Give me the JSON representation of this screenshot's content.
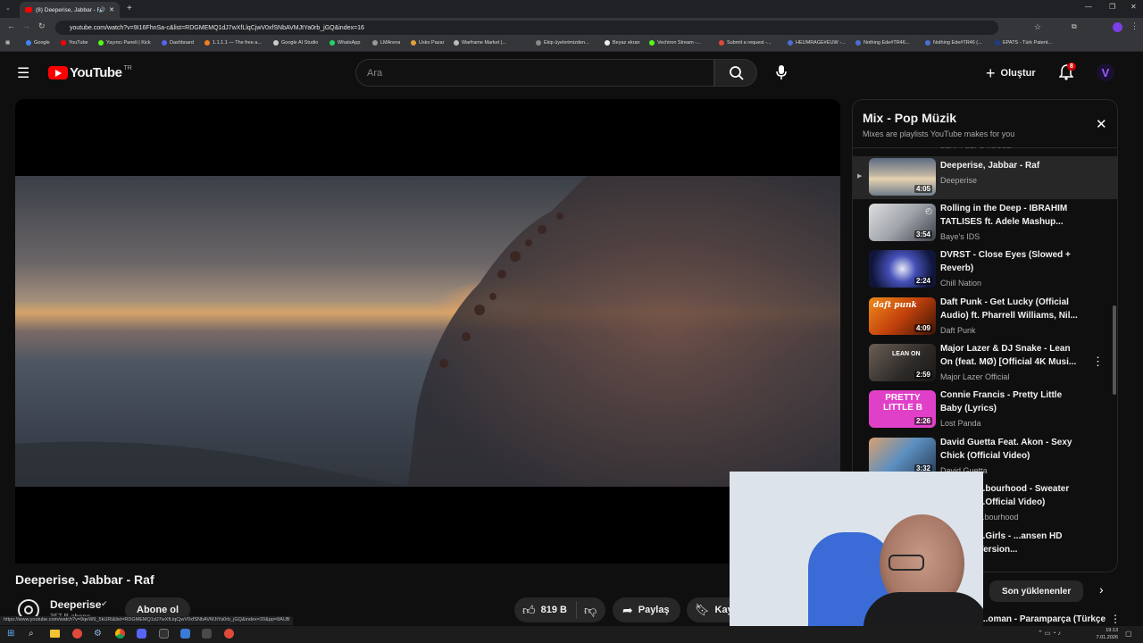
{
  "browser": {
    "tab_title": "(8) Deeperise, Jabbar - Raf",
    "url": "youtube.com/watch?v=9I16FhnSa-c&list=RDGMEMQ1dJ7wXfLlqCjwV0xfSNbAVMJtYa0rb_jGQ&index=16",
    "bookmarks": [
      "Google",
      "YouTube",
      "Yayıncı Paneli | Kick",
      "Dashboard",
      "1.1.1.1 — The free a...",
      "Google AI Studio",
      "WhatsApp",
      "LMArena",
      "Usko Pazar",
      "Warframe Market |...",
      "Ekip üyelerimizden...",
      "Beyaz ekran",
      "Vechiron Stream -...",
      "Submit a request -...",
      "HEUMRAGE#EUW -...",
      "Nothing Ede#TR46...",
      "Nothing Ede#TR46 (...",
      "EPATS - Türk Patent..."
    ],
    "status_url": "https://www.youtube.com/watch?v=9qeW9_5kURI&list=RDGMEMQ1dJ7wXfLlqCjwV0xfSNbAVMJtYa0rb_jGQ&index=20&pp=8AUB"
  },
  "header": {
    "logo": "YouTube",
    "region": "TR",
    "search_placeholder": "Ara",
    "create_label": "Oluştur",
    "notification_count": "8"
  },
  "playlist": {
    "title": "Mix - Pop Müzik",
    "subtitle": "Mixes are playlists YouTube makes for you",
    "partial_above": "BEAT PEEPS HOUSE",
    "items": [
      {
        "title": "Deeperise, Jabbar - Raf",
        "channel": "Deeperise",
        "duration": "4:05",
        "playing": true
      },
      {
        "title": "Rolling in the Deep - IBRAHIM TATLISES ft. Adele Mashup...",
        "channel": "Baye's IDS",
        "duration": "3:54"
      },
      {
        "title": "DVRST - Close Eyes (Slowed + Reverb)",
        "channel": "Chill Nation",
        "duration": "2:24"
      },
      {
        "title": "Daft Punk - Get Lucky (Official Audio) ft. Pharrell Williams, Nil...",
        "channel": "Daft Punk",
        "duration": "4:09"
      },
      {
        "title": "Major Lazer & DJ Snake - Lean On (feat. MØ) [Official 4K Musi...",
        "channel": "Major Lazer Official",
        "duration": "2:59"
      },
      {
        "title": "Connie Francis - Pretty Little Baby (Lyrics)",
        "channel": "Lost Panda",
        "duration": "2:26"
      },
      {
        "title": "David Guetta Feat. Akon - Sexy Chick (Official Video)",
        "channel": "David Guetta",
        "duration": "3:32"
      },
      {
        "title": "...bourhood - Sweater ...Official Video)",
        "channel": "...bourhood",
        "duration": ""
      },
      {
        "title": "...Girls - ...ansen HD Version...",
        "channel": "",
        "duration": ""
      }
    ],
    "thumb_text_pretty": "PRETTY LITTLE B",
    "thumb_text_lean": "LEAN ON",
    "thumb_text_daft": "daft punk"
  },
  "chips": {
    "label": "Son yüklenenler"
  },
  "next_video_partial": "...oman - Paramparça (Türkçe",
  "video": {
    "title": "Deeperise, Jabbar - Raf",
    "channel": "Deeperise",
    "subscribers": "357 B abone",
    "subscribe_label": "Abone ol",
    "likes": "819 B",
    "share_label": "Paylaş",
    "save_label": "Kay"
  },
  "taskbar": {
    "time": "19:13",
    "date": "7.01.2026"
  },
  "colors": {
    "yt_red": "#ff0000",
    "accent_purple": "#7b3fe4",
    "playing_row": "#272727"
  }
}
